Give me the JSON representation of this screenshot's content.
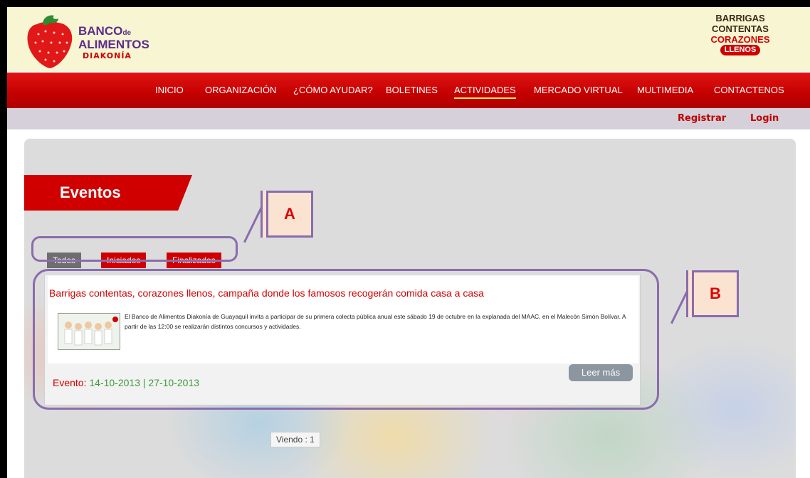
{
  "header": {
    "logo_left": {
      "line1": "BANCO",
      "line1_suffix": "de",
      "line2": "ALIMENTOS",
      "line3": "DIAKONÍA"
    },
    "logo_right": {
      "line1": "BARRIGAS",
      "line2": "CONTENTAS",
      "line3": "CORAZONES",
      "line4": "LLENOS"
    }
  },
  "nav": {
    "items": [
      {
        "label": "INICIO"
      },
      {
        "label": "ORGANIZACIÓN"
      },
      {
        "label": "¿CÓMO AYUDAR?"
      },
      {
        "label": "BOLETINES"
      },
      {
        "label": "ACTIVIDADES",
        "active": true
      },
      {
        "label": "MERCADO VIRTUAL"
      },
      {
        "label": "MULTIMEDIA"
      },
      {
        "label": "CONTACTENOS"
      }
    ]
  },
  "subbar": {
    "register": "Registrar",
    "login": "Login"
  },
  "section": {
    "title": "Eventos"
  },
  "filters": [
    {
      "label": "Todos",
      "selected": true
    },
    {
      "label": "Iniciados",
      "selected": false
    },
    {
      "label": "Finalizados",
      "selected": false
    }
  ],
  "event": {
    "title": "Barrigas contentas, corazones llenos, campaña donde los famosos recogerán comida casa a casa",
    "description": "El Banco de Alimentos Diakonía de Guayaquil invita a participar de su primera colecta pública anual este sábado 19 de octubre en la explanada del MAAC, en el Malecón Simón Bolívar. A partir de las 12:00 se realizarán distintos concursos y actividades.",
    "read_more": "Leer más",
    "date_label": "Evento:",
    "date_range": "14-10-2013 | 27-10-2013"
  },
  "pagination": {
    "viewing": "Viendo : 1"
  },
  "annotations": {
    "a": "A",
    "b": "B"
  },
  "colors": {
    "brand_red": "#d00000",
    "annotation_purple": "#8a6cad",
    "header_bg": "#f8f5d2",
    "date_green": "#3c9a3c"
  }
}
